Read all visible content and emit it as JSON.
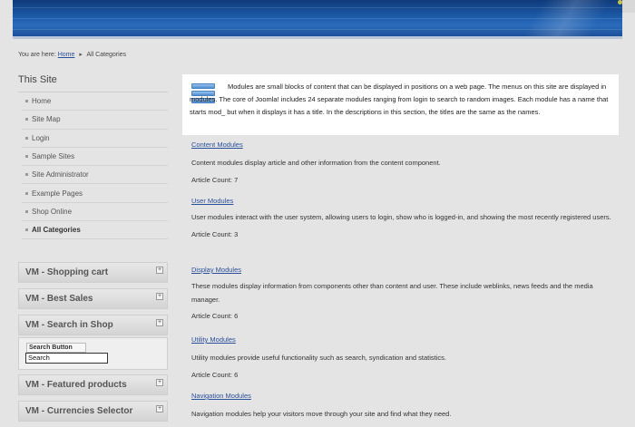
{
  "breadcrumb": {
    "prefix": "You are here:",
    "home": "Home",
    "current": "All Categories"
  },
  "sidebar": {
    "title": "This Site",
    "items": [
      {
        "label": "Home"
      },
      {
        "label": "Site Map"
      },
      {
        "label": "Login"
      },
      {
        "label": "Sample Sites"
      },
      {
        "label": "Site Administrator"
      },
      {
        "label": "Example Pages"
      },
      {
        "label": "Shop Online"
      },
      {
        "label": "All Categories"
      }
    ]
  },
  "modules": {
    "shopping_cart": "VM - Shopping cart",
    "best_sales": "VM - Best Sales",
    "search_in_shop": "VM - Search in Shop",
    "featured": "VM - Featured products",
    "currencies": "VM - Currencies Selector",
    "plus": "+"
  },
  "search": {
    "button": "Search Button",
    "value": "Search"
  },
  "intro": {
    "text": "Modules are small blocks of content that can be displayed in positions on a web page. The menus on this site are displayed in modules. The core of Joomla! includes 24 separate modules ranging from login to search to random images. Each module has a name that starts mod_ but when it displays it has a title. In the descriptions in this section, the titles are the same as the names."
  },
  "categories": [
    {
      "title": "Content Modules",
      "desc": "Content modules display article and other information from the content component.",
      "count": "Article Count: 7"
    },
    {
      "title": "User Modules",
      "desc": "User modules interact with the user system, allowing users to login, show who is logged-in, and showing the most recently registered users.",
      "count": "Article Count: 3"
    },
    {
      "title": "Display Modules",
      "desc": "These modules display information from components other than content and user. These include weblinks, news feeds and the media manager.",
      "count": "Article Count: 6"
    },
    {
      "title": "Utility Modules",
      "desc": "Utility modules provide useful functionality such as search, syndication and statistics.",
      "count": "Article Count: 6"
    },
    {
      "title": "Navigation Modules",
      "desc": "Navigation modules help your visitors move through your site and find what they need.",
      "count": ""
    }
  ]
}
